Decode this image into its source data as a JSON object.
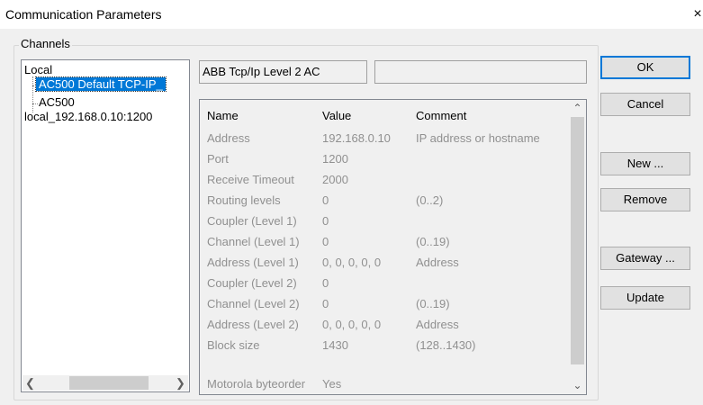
{
  "window": {
    "title": "Communication Parameters",
    "close_glyph": "×"
  },
  "channels": {
    "label": "Channels",
    "tree": [
      {
        "label": "Local"
      },
      {
        "label": "AC500 Default TCP-IP_",
        "selected": true
      },
      {
        "label": "AC500"
      },
      {
        "label": "local_192.168.0.10:1200"
      }
    ]
  },
  "driver": {
    "name": "ABB Tcp/Ip Level 2 AC",
    "extra": ""
  },
  "params": {
    "headers": {
      "name": "Name",
      "value": "Value",
      "comment": "Comment"
    },
    "rows": [
      {
        "name": "Address",
        "value": "192.168.0.10",
        "comment": "IP address or hostname"
      },
      {
        "name": "Port",
        "value": "1200",
        "comment": ""
      },
      {
        "name": "Receive Timeout",
        "value": "2000",
        "comment": ""
      },
      {
        "name": "Routing levels",
        "value": "0",
        "comment": "(0..2)"
      },
      {
        "name": "Coupler (Level 1)",
        "value": "0",
        "comment": ""
      },
      {
        "name": "Channel (Level 1)",
        "value": "0",
        "comment": "(0..19)"
      },
      {
        "name": "Address (Level 1)",
        "value": "0, 0, 0, 0, 0",
        "comment": "Address"
      },
      {
        "name": "Coupler (Level 2)",
        "value": "0",
        "comment": ""
      },
      {
        "name": "Channel (Level 2)",
        "value": "0",
        "comment": "(0..19)"
      },
      {
        "name": "Address (Level 2)",
        "value": "0, 0, 0, 0, 0",
        "comment": "Address"
      },
      {
        "name": "Block size",
        "value": "1430",
        "comment": "(128..1430)"
      },
      {
        "name": "Motorola byteorder",
        "value": "Yes",
        "comment": ""
      }
    ]
  },
  "buttons": {
    "ok": "OK",
    "cancel": "Cancel",
    "new": "New ...",
    "remove": "Remove",
    "gateway": "Gateway ...",
    "update": "Update"
  },
  "icons": {
    "scroll_left": "arrow-left-icon",
    "scroll_right": "arrow-right-icon",
    "scroll_up": "arrow-up-icon",
    "scroll_down": "arrow-down-icon"
  },
  "colors": {
    "selection": "#0078d7",
    "default_button_border": "#0078d7"
  }
}
